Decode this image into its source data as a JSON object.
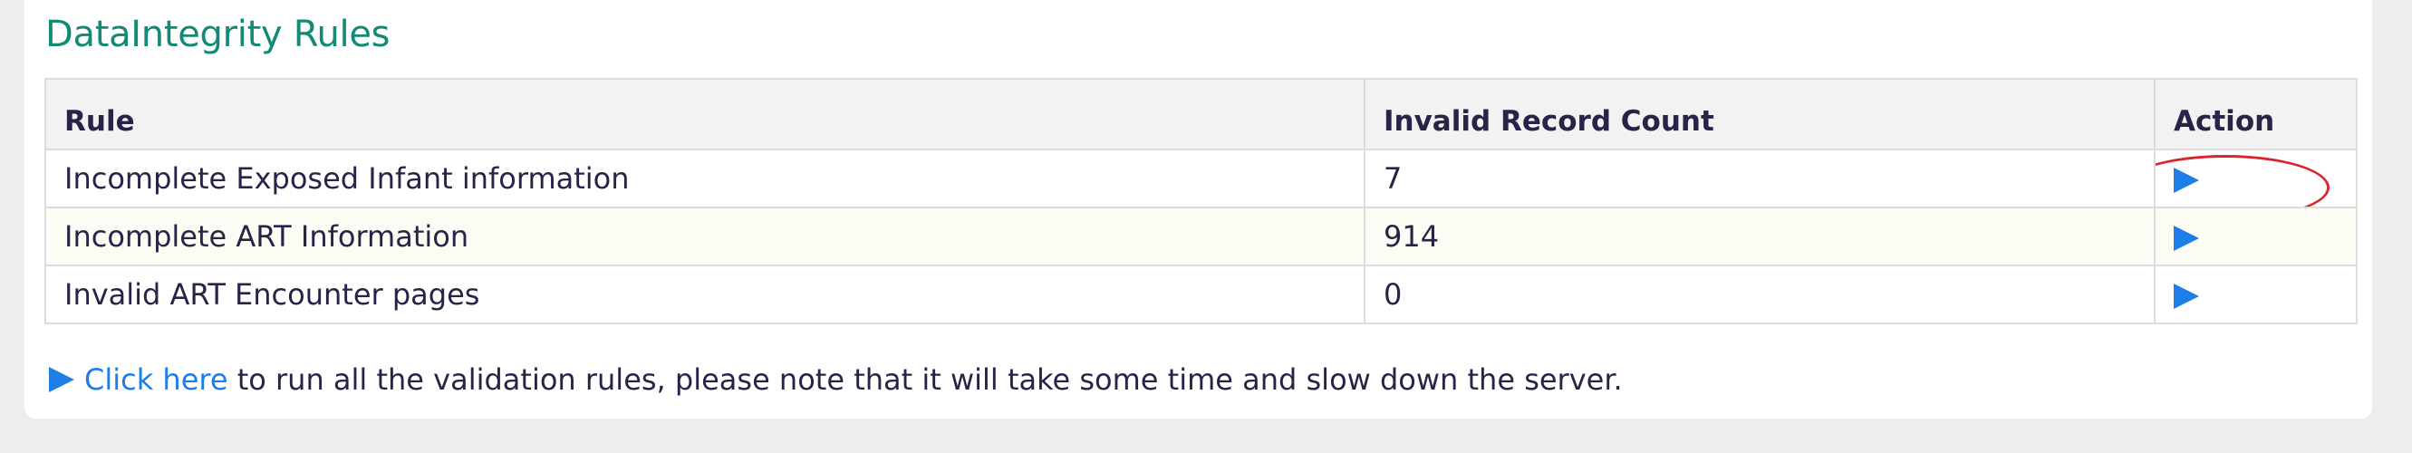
{
  "panel": {
    "title": "DataIntegrity Rules"
  },
  "table": {
    "headers": {
      "rule": "Rule",
      "count": "Invalid Record Count",
      "action": "Action"
    },
    "rows": [
      {
        "rule": "Incomplete Exposed Infant information",
        "count": "7",
        "action_icon": "play-icon"
      },
      {
        "rule": "Incomplete ART Information",
        "count": "914",
        "action_icon": "play-icon"
      },
      {
        "rule": "Invalid ART Encounter pages",
        "count": "0",
        "action_icon": "play-icon"
      }
    ]
  },
  "footer": {
    "icon": "play-icon",
    "link_text": "Click here",
    "text": " to run all the validation rules, please note that it will take some time and slow down the server."
  },
  "colors": {
    "title": "#148a76",
    "link": "#1f7de8",
    "play_icon": "#1f7de8",
    "highlight": "#d7262e",
    "text": "#2b2347"
  }
}
